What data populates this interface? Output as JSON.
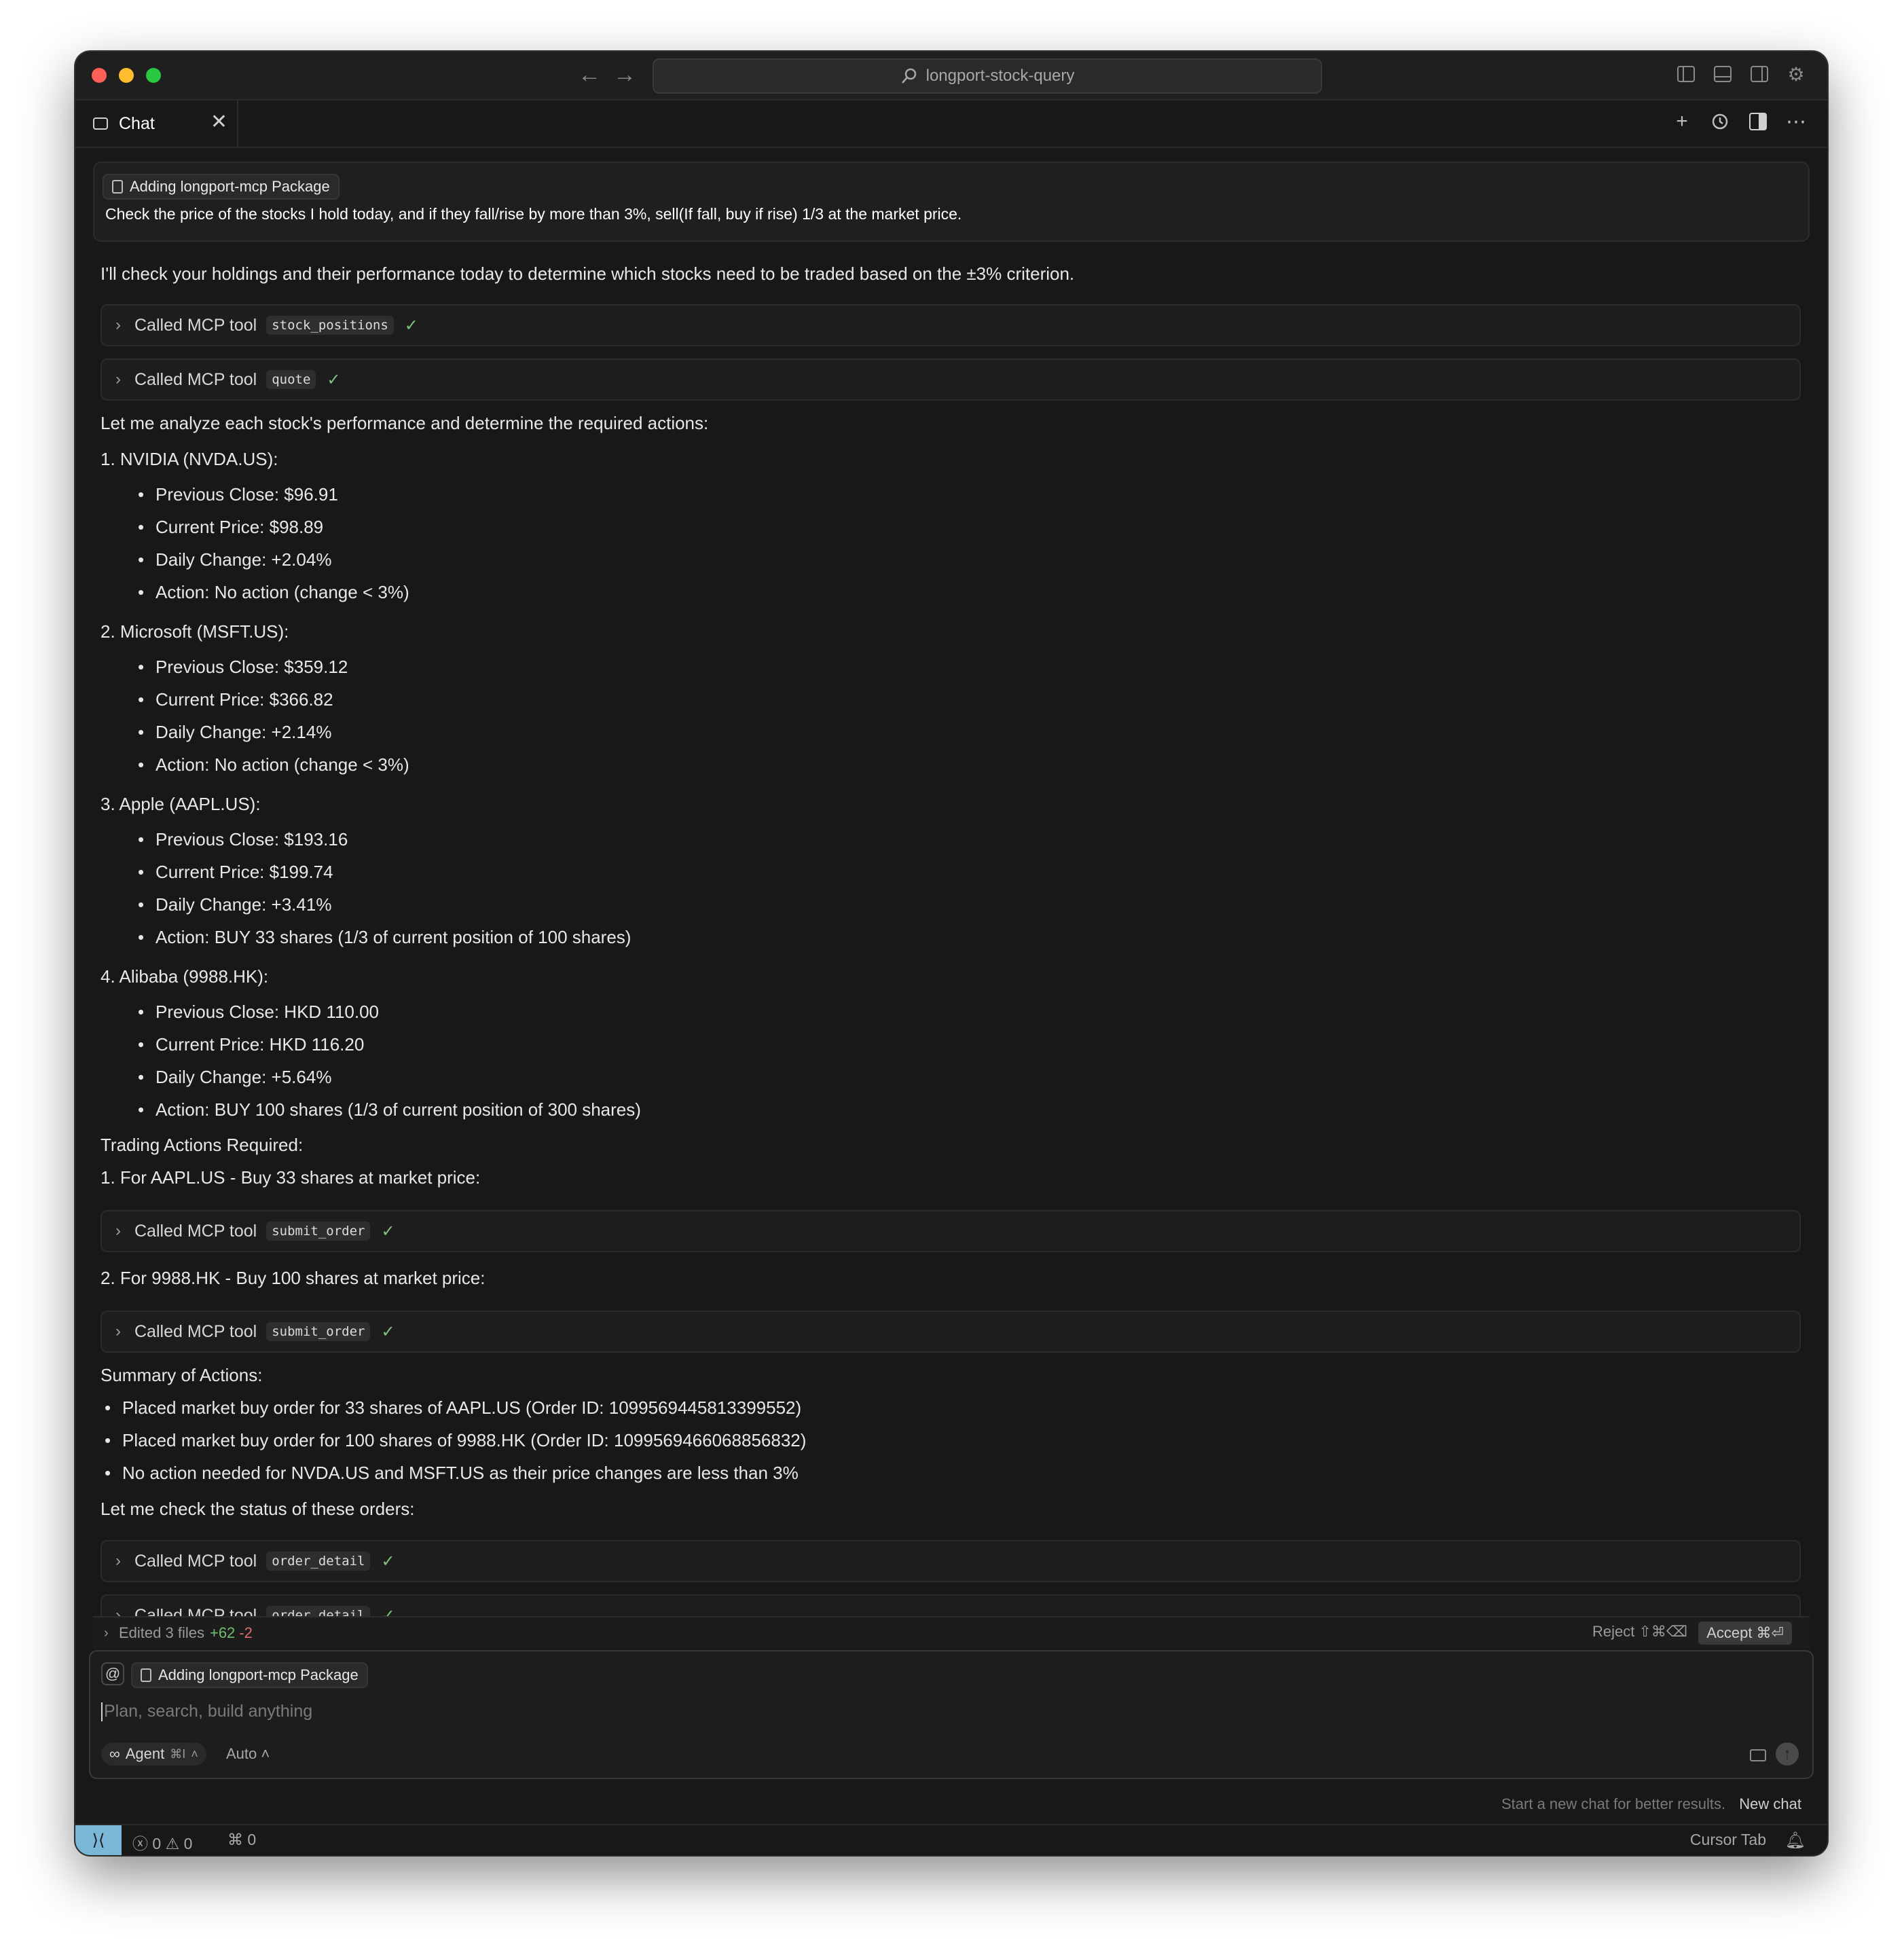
{
  "window": {
    "search_text": "longport-stock-query",
    "nav_back": "←",
    "nav_forward": "→"
  },
  "tab": {
    "label": "Chat",
    "close": "✕"
  },
  "user_message": {
    "context_pill": "Adding longport-mcp Package",
    "text": "Check the price of the stocks I hold today, and if they fall/rise by more than 3%, sell(If fall, buy if rise) 1/3 at the market price."
  },
  "assistant": {
    "intro": "I'll check your holdings and their performance today to determine which stocks need to be traded based on the ±3% criterion.",
    "tool_label": "Called MCP tool",
    "tool_check": "✓",
    "tools": {
      "t1": "stock_positions",
      "t2": "quote",
      "t3": "submit_order",
      "t4": "submit_order",
      "t5": "order_detail",
      "t6": "order_detail"
    },
    "analyze_heading": "Let me analyze each stock's performance and determine the required actions:",
    "stocks": [
      {
        "heading": "1. NVIDIA (NVDA.US):",
        "prev": "Previous Close: $96.91",
        "curr": "Current Price: $98.89",
        "change": "Daily Change: +2.04%",
        "action": "Action: No action (change < 3%)"
      },
      {
        "heading": "2. Microsoft (MSFT.US):",
        "prev": "Previous Close: $359.12",
        "curr": "Current Price: $366.82",
        "change": "Daily Change: +2.14%",
        "action": "Action: No action (change < 3%)"
      },
      {
        "heading": "3. Apple (AAPL.US):",
        "prev": "Previous Close: $193.16",
        "curr": "Current Price: $199.74",
        "change": "Daily Change: +3.41%",
        "action": "Action: BUY 33 shares (1/3 of current position of 100 shares)"
      },
      {
        "heading": "4. Alibaba (9988.HK):",
        "prev": "Previous Close: HKD 110.00",
        "curr": "Current Price: HKD 116.20",
        "change": "Daily Change: +5.64%",
        "action": "Action: BUY 100 shares (1/3 of current position of 300 shares)"
      }
    ],
    "trading_heading": "Trading Actions Required:",
    "trade1": "1. For AAPL.US - Buy 33 shares at market price:",
    "trade2": "2. For 9988.HK - Buy 100 shares at market price:",
    "summary_heading": "Summary of Actions:",
    "summary": [
      "Placed market buy order for 33 shares of AAPL.US (Order ID: 1099569445813399552)",
      "Placed market buy order for 100 shares of 9988.HK (Order ID: 1099569466068856832)",
      "No action needed for NVDA.US and MSFT.US as their price changes are less than 3%"
    ],
    "status_check": "Let me check the status of these orders:"
  },
  "edited_bar": {
    "label": "Edited 3 files",
    "added": "+62",
    "removed": "-2",
    "reject": "Reject ⇧⌘⌫",
    "accept": "Accept ⌘⏎"
  },
  "composer": {
    "at": "@",
    "context_pill": "Adding longport-mcp Package",
    "placeholder": "Plan, search, build anything",
    "mode": "Agent",
    "mode_shortcut": "⌘I",
    "model": "Auto"
  },
  "hint": {
    "text": "Start a new chat for better results.",
    "action": "New chat"
  },
  "statusbar": {
    "errors": "0",
    "warnings": "0",
    "ports": "0",
    "right": "Cursor Tab"
  },
  "colors": {
    "background": "#181818",
    "accent_remote": "#7ab7d6",
    "added": "#6fbf6f",
    "removed": "#e06c6c"
  }
}
